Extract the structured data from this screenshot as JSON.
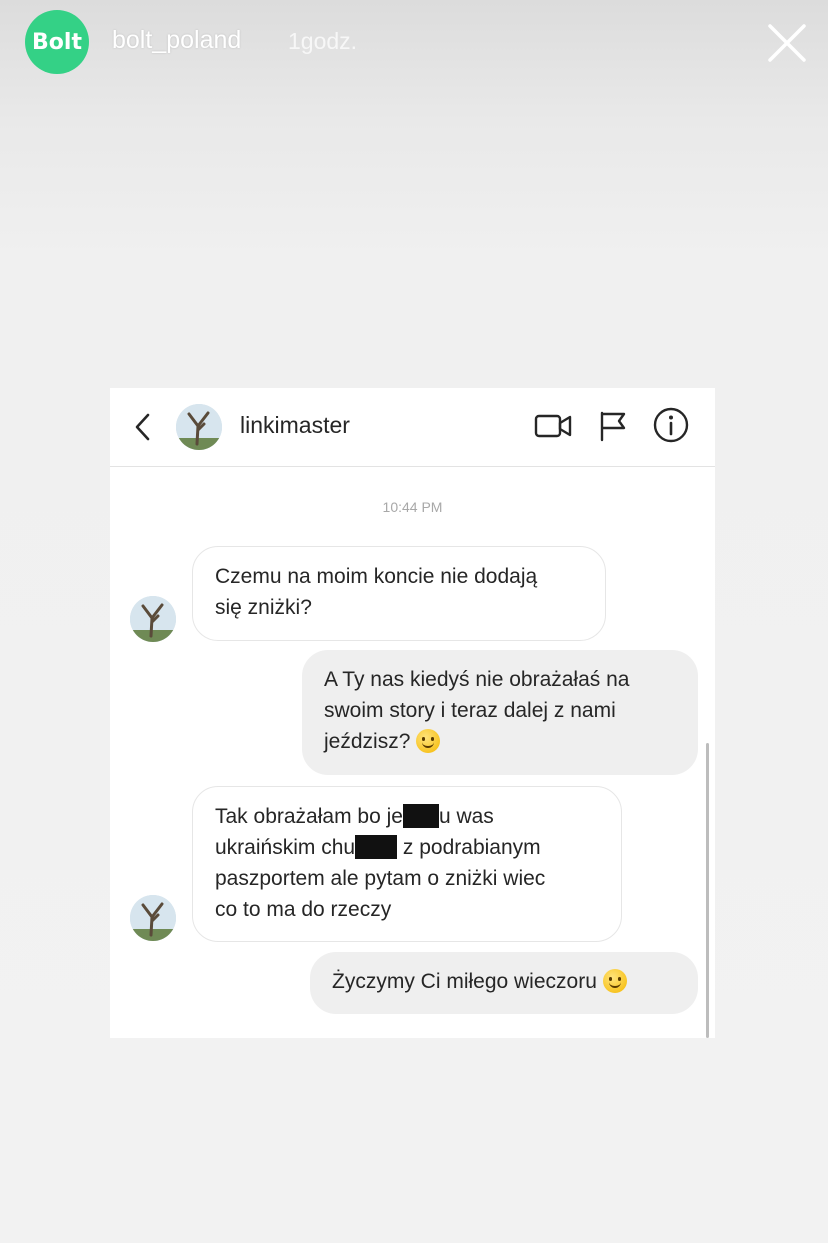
{
  "story": {
    "avatar_text": "Bolt",
    "username": "bolt_poland",
    "time": "1godz.",
    "brand_color": "#34d186"
  },
  "chat": {
    "contact_name": "linkimaster",
    "timestamp": "10:44 PM",
    "icons": [
      "back-icon",
      "video-call-icon",
      "flag-icon",
      "info-icon"
    ],
    "messages": [
      {
        "side": "incoming",
        "lines": [
          "Czemu na moim koncie nie dodają",
          "się zniżki?"
        ]
      },
      {
        "side": "outgoing",
        "lines": [
          "A Ty nas kiedyś nie obrażałaś na",
          "swoim story i teraz dalej z nami",
          "jeździsz?"
        ],
        "emoji": "slightly-smiling-face"
      },
      {
        "side": "incoming",
        "lines": [
          "Tak obrażałam bo je",
          "u was",
          "ukraińskim chu",
          "z podrabianym",
          "paszportem ale pytam o zniżki wiec",
          "co to ma do rzeczy"
        ]
      },
      {
        "side": "outgoing",
        "lines": [
          "Życzymy Ci miłego wieczoru"
        ],
        "emoji": "slightly-smiling-face"
      }
    ]
  }
}
